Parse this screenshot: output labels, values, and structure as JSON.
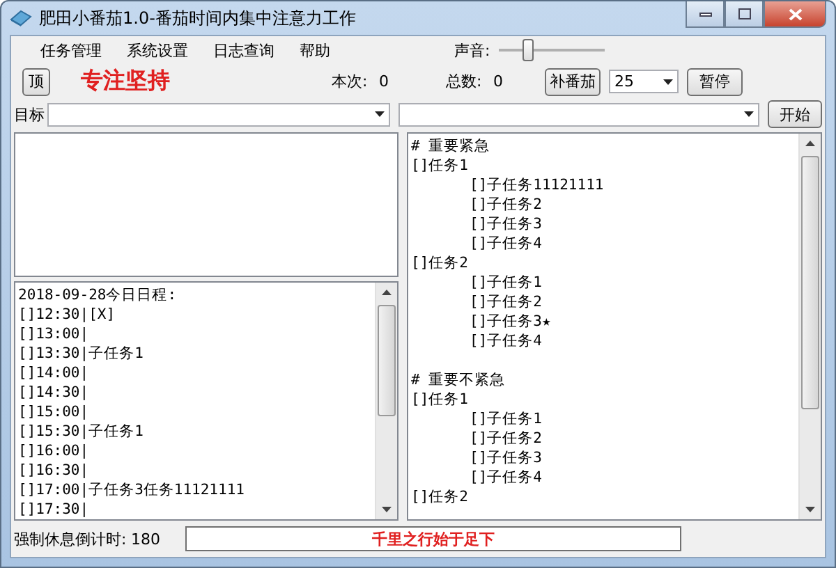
{
  "window": {
    "title": "肥田小番茄1.0-番茄时间内集中注意力工作"
  },
  "menu": [
    "任务管理",
    "系统设置",
    "日志查询",
    "帮助"
  ],
  "volume": {
    "label": "声音:",
    "level": 0.25
  },
  "toolbar": {
    "top_button": "顶",
    "slogan": "专注坚持",
    "current_label": "本次:",
    "current_value": "0",
    "total_label": "总数:",
    "total_value": "0",
    "add_button": "补番茄",
    "minutes": "25",
    "pause_button": "暂停"
  },
  "target": {
    "label": "目标",
    "start_button": "开始"
  },
  "schedule": [
    "2018-09-28今日日程:",
    "[]12:30|[X]",
    "[]13:00|",
    "[]13:30|子任务1",
    "[]14:00|",
    "[]14:30|",
    "[]15:00|",
    "[]15:30|子任务1",
    "[]16:00|",
    "[]16:30|",
    "[]17:00|子任务3任务11121111",
    "[]17:30|"
  ],
  "tasks": [
    {
      "heading": "# 重要紧急",
      "items": [
        {
          "text": "[]任务1",
          "children": [
            {
              "text": "[]子任务11121111"
            },
            {
              "text": "[]子任务2"
            },
            {
              "text": "[]子任务3"
            },
            {
              "text": "[]子任务4"
            }
          ]
        },
        {
          "text": "[]任务2",
          "children": [
            {
              "text": "[]子任务1"
            },
            {
              "text": "[]子任务2"
            },
            {
              "text": "[]子任务3★"
            },
            {
              "text": "[]子任务4"
            }
          ]
        }
      ]
    },
    {
      "heading": "# 重要不紧急",
      "items": [
        {
          "text": "[]任务1",
          "children": [
            {
              "text": "[]子任务1"
            },
            {
              "text": "[]子任务2"
            },
            {
              "text": "[]子任务3"
            },
            {
              "text": "[]子任务4"
            }
          ]
        },
        {
          "text": "[]任务2"
        }
      ]
    }
  ],
  "status": {
    "countdown_label": "强制休息倒计时:",
    "countdown_value": "180",
    "motto": "千里之行始于足下"
  }
}
